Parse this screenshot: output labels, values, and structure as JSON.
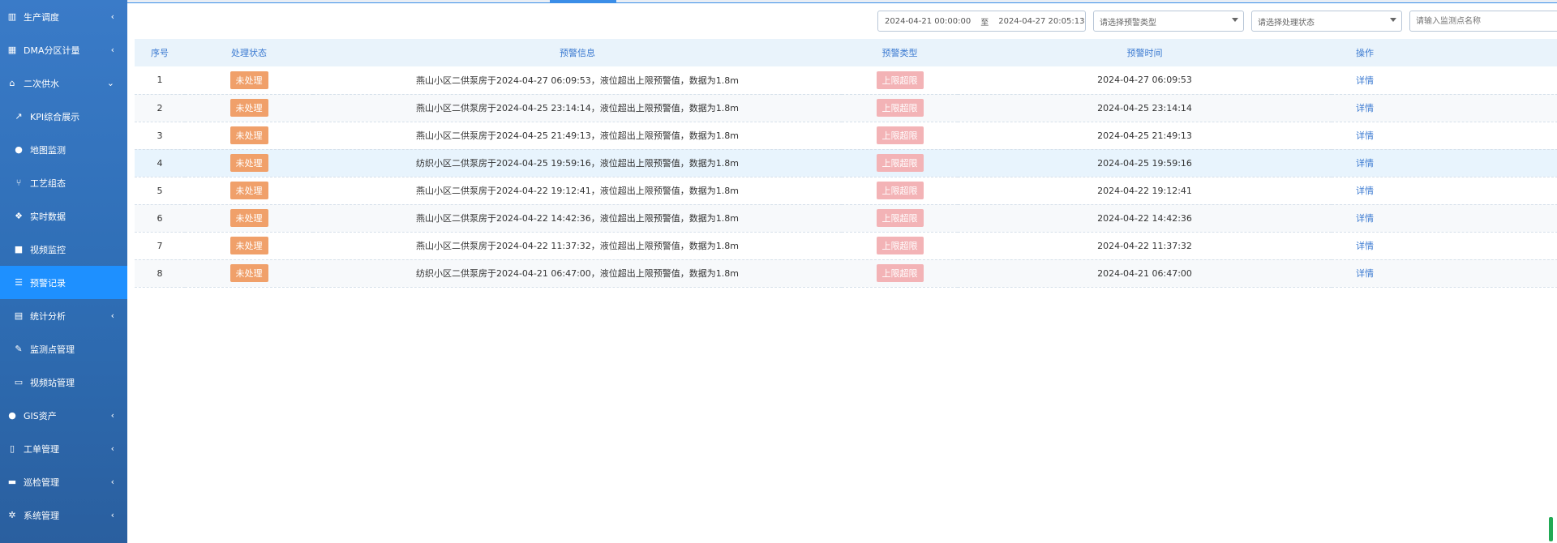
{
  "sidebar": {
    "items": [
      {
        "label": "生产调度",
        "icon": "bar-chart-icon",
        "chevron": "‹",
        "sub": false,
        "active": false
      },
      {
        "label": "DMA分区计量",
        "icon": "grid-icon",
        "chevron": "‹",
        "sub": false,
        "active": false
      },
      {
        "label": "二次供水",
        "icon": "home-icon",
        "chevron": "⌄",
        "sub": false,
        "active": false
      },
      {
        "label": "KPI综合展示",
        "icon": "line-chart-icon",
        "chevron": "",
        "sub": true,
        "active": false
      },
      {
        "label": "地图监测",
        "icon": "globe-icon",
        "chevron": "",
        "sub": true,
        "active": false
      },
      {
        "label": "工艺组态",
        "icon": "fork-icon",
        "chevron": "",
        "sub": true,
        "active": false
      },
      {
        "label": "实时数据",
        "icon": "cubes-icon",
        "chevron": "",
        "sub": true,
        "active": false
      },
      {
        "label": "视频监控",
        "icon": "video-icon",
        "chevron": "",
        "sub": true,
        "active": false
      },
      {
        "label": "预警记录",
        "icon": "list-icon",
        "chevron": "",
        "sub": true,
        "active": true
      },
      {
        "label": "统计分析",
        "icon": "calendar-icon",
        "chevron": "‹",
        "sub": true,
        "active": false
      },
      {
        "label": "监测点管理",
        "icon": "wrench-icon",
        "chevron": "",
        "sub": true,
        "active": false
      },
      {
        "label": "视频站管理",
        "icon": "file-icon",
        "chevron": "",
        "sub": true,
        "active": false
      },
      {
        "label": "GIS资产",
        "icon": "globe-icon",
        "chevron": "‹",
        "sub": false,
        "active": false
      },
      {
        "label": "工单管理",
        "icon": "document-icon",
        "chevron": "‹",
        "sub": false,
        "active": false
      },
      {
        "label": "巡检管理",
        "icon": "briefcase-icon",
        "chevron": "‹",
        "sub": false,
        "active": false
      },
      {
        "label": "系统管理",
        "icon": "gears-icon",
        "chevron": "‹",
        "sub": false,
        "active": false
      }
    ]
  },
  "filters": {
    "date_start": "2024-04-21 00:00:00",
    "date_sep": "至",
    "date_end": "2024-04-27 20:05:13",
    "type_placeholder": "请选择预警类型",
    "status_placeholder": "请选择处理状态",
    "search_placeholder": "请输入监测点名称"
  },
  "table": {
    "headers": {
      "no": "序号",
      "status": "处理状态",
      "info": "预警信息",
      "type": "预警类型",
      "time": "预警时间",
      "op": "操作"
    },
    "rows": [
      {
        "no": "1",
        "status": "未处理",
        "info": "燕山小区二供泵房于2024-04-27 06:09:53，液位超出上限预警值，数据为1.8m",
        "type": "上限超限",
        "time": "2024-04-27 06:09:53",
        "op": "详情"
      },
      {
        "no": "2",
        "status": "未处理",
        "info": "燕山小区二供泵房于2024-04-25 23:14:14，液位超出上限预警值，数据为1.8m",
        "type": "上限超限",
        "time": "2024-04-25 23:14:14",
        "op": "详情"
      },
      {
        "no": "3",
        "status": "未处理",
        "info": "燕山小区二供泵房于2024-04-25 21:49:13，液位超出上限预警值，数据为1.8m",
        "type": "上限超限",
        "time": "2024-04-25 21:49:13",
        "op": "详情"
      },
      {
        "no": "4",
        "status": "未处理",
        "info": "纺织小区二供泵房于2024-04-25 19:59:16，液位超出上限预警值，数据为1.8m",
        "type": "上限超限",
        "time": "2024-04-25 19:59:16",
        "op": "详情"
      },
      {
        "no": "5",
        "status": "未处理",
        "info": "燕山小区二供泵房于2024-04-22 19:12:41，液位超出上限预警值，数据为1.8m",
        "type": "上限超限",
        "time": "2024-04-22 19:12:41",
        "op": "详情"
      },
      {
        "no": "6",
        "status": "未处理",
        "info": "燕山小区二供泵房于2024-04-22 14:42:36，液位超出上限预警值，数据为1.8m",
        "type": "上限超限",
        "time": "2024-04-22 14:42:36",
        "op": "详情"
      },
      {
        "no": "7",
        "status": "未处理",
        "info": "燕山小区二供泵房于2024-04-22 11:37:32，液位超出上限预警值，数据为1.8m",
        "type": "上限超限",
        "time": "2024-04-22 11:37:32",
        "op": "详情"
      },
      {
        "no": "8",
        "status": "未处理",
        "info": "纺织小区二供泵房于2024-04-21 06:47:00，液位超出上限预警值，数据为1.8m",
        "type": "上限超限",
        "time": "2024-04-21 06:47:00",
        "op": "详情"
      }
    ]
  },
  "colors": {
    "sidebar_bg": "#2e6db4",
    "active_bg": "#1e90ff",
    "status_badge": "#f0a06a",
    "type_badge": "#f3b3b6",
    "header_text": "#3b7ad1"
  }
}
